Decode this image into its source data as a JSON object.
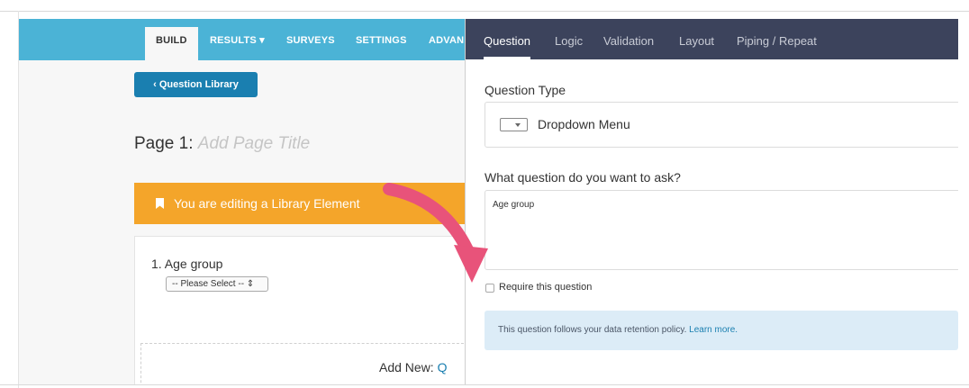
{
  "builder": {
    "nav_tabs": [
      "BUILD",
      "RESULTS ▾",
      "SURVEYS",
      "SETTINGS",
      "ADVAN"
    ],
    "question_library_button": "Question Library",
    "page_title_prefix": "Page 1:",
    "page_title_placeholder": "Add Page Title",
    "library_banner": "You are editing a Library Element",
    "question_label": "1. Age group",
    "question_select_value": "-- Please Select -- ⇕",
    "add_new_label": "Add New:",
    "add_new_cut": "Q"
  },
  "panel": {
    "tabs": [
      "Question",
      "Logic",
      "Validation",
      "Layout",
      "Piping / Repeat"
    ],
    "question_type_label": "Question Type",
    "question_type_value": "Dropdown Menu",
    "question_text_label": "What question do you want to ask?",
    "question_text_value": "Age group",
    "require_label": "Require this question",
    "require_checked": false,
    "info_text": "This question follows your data retention policy.",
    "info_link": "Learn more."
  },
  "colors": {
    "topbar": "#4bb3d6",
    "banner": "#f4a52a",
    "panel_header": "#3c435c",
    "arrow": "#e8537a",
    "info_bg": "#dcecf7"
  }
}
